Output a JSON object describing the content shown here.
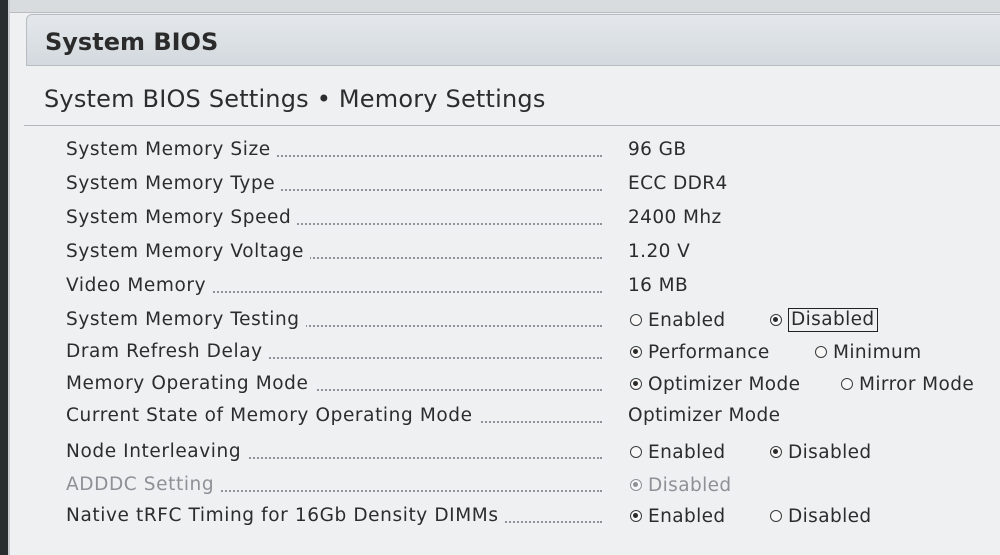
{
  "header": {
    "title": "System BIOS"
  },
  "section": {
    "title": "System BIOS Settings • Memory Settings"
  },
  "rows": [
    {
      "label": "System Memory Size",
      "value": "96 GB"
    },
    {
      "label": "System Memory Type",
      "value": "ECC DDR4"
    },
    {
      "label": "System Memory Speed",
      "value": "2400 Mhz"
    },
    {
      "label": "System Memory Voltage",
      "value": "1.20 V"
    },
    {
      "label": "Video Memory",
      "value": "16 MB"
    },
    {
      "label": "System Memory Testing",
      "options": [
        {
          "label": "Enabled",
          "selected": false
        },
        {
          "label": "Disabled",
          "selected": true,
          "focused": true
        }
      ]
    },
    {
      "label": "Dram Refresh Delay",
      "options": [
        {
          "label": "Performance",
          "selected": true
        },
        {
          "label": "Minimum",
          "selected": false
        }
      ]
    },
    {
      "label": "Memory Operating Mode",
      "options": [
        {
          "label": "Optimizer Mode",
          "selected": true
        },
        {
          "label": "Mirror Mode",
          "selected": false
        }
      ]
    },
    {
      "label": "Current State of Memory Operating Mode",
      "value": "Optimizer Mode"
    },
    {
      "label": "Node Interleaving",
      "options": [
        {
          "label": "Enabled",
          "selected": false
        },
        {
          "label": "Disabled",
          "selected": true
        }
      ]
    },
    {
      "label": "ADDDC Setting",
      "disabled": true,
      "options": [
        {
          "label": "Disabled",
          "selected": true
        }
      ]
    },
    {
      "label": "Native tRFC Timing for 16Gb Density DIMMs",
      "options": [
        {
          "label": "Enabled",
          "selected": true
        },
        {
          "label": "Disabled",
          "selected": false
        }
      ]
    }
  ]
}
